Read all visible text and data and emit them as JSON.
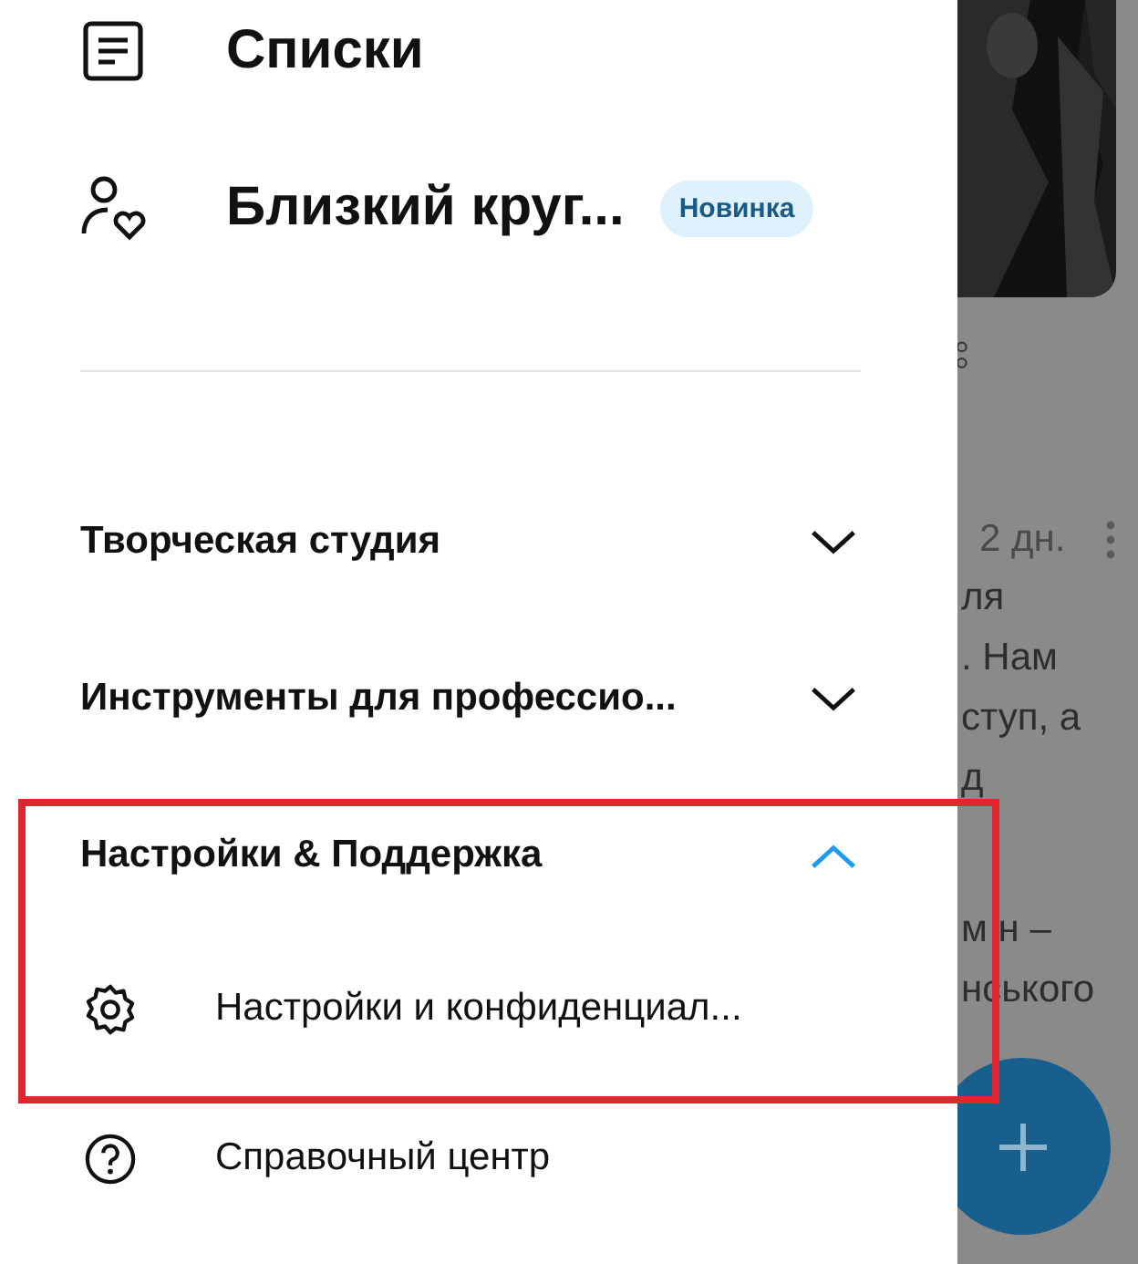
{
  "primary_items": [
    {
      "label": "Списки",
      "kind": "list"
    },
    {
      "label": "Близкий круг...",
      "kind": "circle",
      "badge": "Новинка"
    }
  ],
  "sections": [
    {
      "title": "Творческая студия",
      "expanded": false,
      "highlighted": false
    },
    {
      "title": "Инструменты для профессио...",
      "expanded": false,
      "highlighted": false
    },
    {
      "title": "Настройки & Поддержка",
      "expanded": true,
      "highlighted": true,
      "children": [
        {
          "label": "Настройки и конфиденциал...",
          "kind": "settings"
        },
        {
          "label": "Справочный центр",
          "kind": "help"
        }
      ]
    }
  ],
  "feed": {
    "time": "2 дн.",
    "paragraphs": [
      [
        "ля",
        ". Нам",
        "ступ, а",
        "д"
      ],
      [
        "м н –",
        "нського"
      ]
    ]
  }
}
